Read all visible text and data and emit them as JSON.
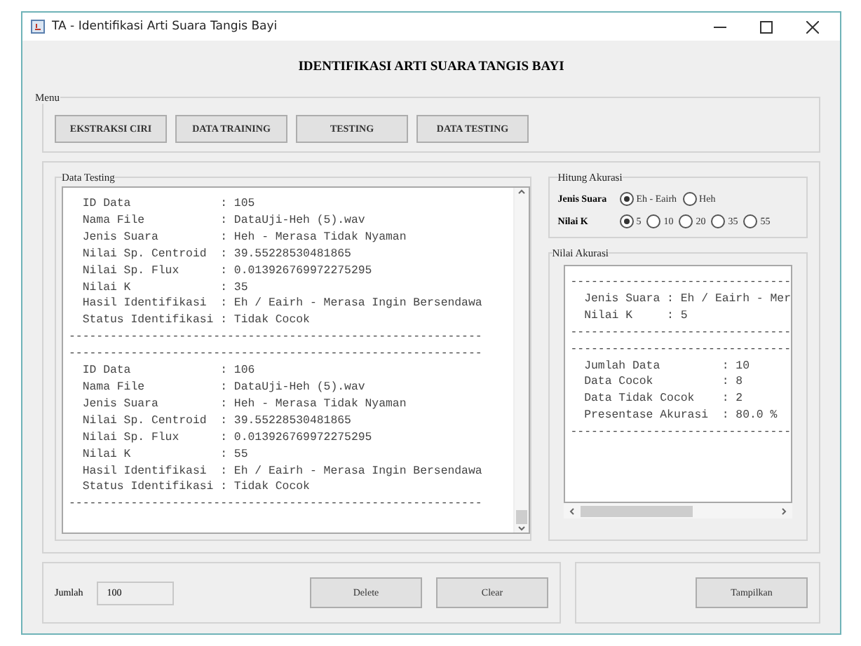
{
  "window": {
    "title": "TA - Identifikasi Arti Suara Tangis Bayi"
  },
  "heading": "IDENTIFIKASI ARTI SUARA TANGIS BAYI",
  "menu": {
    "title": "Menu",
    "buttons": [
      "EKSTRAKSI CIRI",
      "DATA TRAINING",
      "TESTING",
      "DATA TESTING"
    ]
  },
  "data_testing": {
    "title": "Data Testing",
    "lines": [
      "  ID Data             : 105",
      "  Nama File           : DataUji-Heh (5).wav",
      "  Jenis Suara         : Heh - Merasa Tidak Nyaman",
      "  Nilai Sp. Centroid  : 39.55228530481865",
      "  Nilai Sp. Flux      : 0.013926769972275295",
      "  Nilai K             : 35",
      "  Hasil Identifikasi  : Eh / Eairh - Merasa Ingin Bersendawa",
      "  Status Identifikasi : Tidak Cocok",
      "------------------------------------------------------------",
      "------------------------------------------------------------",
      "  ID Data             : 106",
      "  Nama File           : DataUji-Heh (5).wav",
      "  Jenis Suara         : Heh - Merasa Tidak Nyaman",
      "  Nilai Sp. Centroid  : 39.55228530481865",
      "  Nilai Sp. Flux      : 0.013926769972275295",
      "  Nilai K             : 55",
      "  Hasil Identifikasi  : Eh / Eairh - Merasa Ingin Bersendawa",
      "  Status Identifikasi : Tidak Cocok",
      "------------------------------------------------------------"
    ]
  },
  "hitung_akurasi": {
    "title": "Hitung Akurasi",
    "groups": [
      {
        "label": "Jenis Suara",
        "options": [
          {
            "label": "Eh - Eairh",
            "selected": true
          },
          {
            "label": "Heh",
            "selected": false
          }
        ]
      },
      {
        "label": "Nilai K",
        "options": [
          {
            "label": "5",
            "selected": true
          },
          {
            "label": "10",
            "selected": false
          },
          {
            "label": "20",
            "selected": false
          },
          {
            "label": "35",
            "selected": false
          },
          {
            "label": "55",
            "selected": false
          }
        ]
      }
    ]
  },
  "nilai_akurasi": {
    "title": "Nilai Akurasi",
    "lines": [
      "--------------------------------",
      "  Jenis Suara : Eh / Eairh - Mer",
      "  Nilai K     : 5",
      "--------------------------------",
      "--------------------------------",
      "  Jumlah Data         : 10",
      "  Data Cocok          : 8",
      "  Data Tidak Cocok    : 2",
      "  Presentase Akurasi  : 80.0 %",
      "--------------------------------"
    ]
  },
  "jumlah": {
    "label": "Jumlah",
    "value": "100"
  },
  "bottom_buttons": [
    "Delete",
    "Clear"
  ],
  "show_button": "Tampilkan"
}
